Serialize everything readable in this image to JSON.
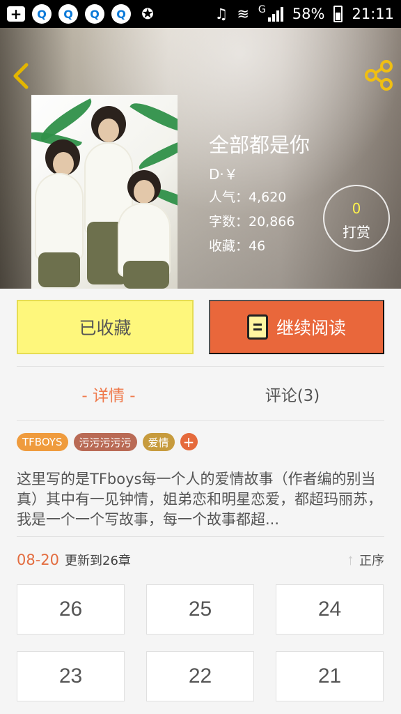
{
  "status_bar": {
    "network": "G",
    "battery": "58%",
    "time": "21:11",
    "icons": [
      "add-icon",
      "qq-icon",
      "qq-icon",
      "qq-icon",
      "qq-icon",
      "weibo-icon",
      "headphone-icon",
      "wifi-icon",
      "signal-icon",
      "battery-icon"
    ]
  },
  "book": {
    "title": "全部都是你",
    "author": "D·￥",
    "popularity_label": "人气：4,620",
    "words_label": "字数：20,866",
    "favorites_label": "收藏：46"
  },
  "tip": {
    "count": "0",
    "label": "打赏"
  },
  "actions": {
    "favorite_label": "已收藏",
    "continue_label": "继续阅读"
  },
  "tabs": {
    "detail": "- 详情 -",
    "comments": "评论(3)"
  },
  "tags": [
    "TFBOYS",
    "污污污污污",
    "爱情"
  ],
  "add_tag": "+",
  "description": "这里写的是TFboys每一个人的爱情故事（作者编的别当真）其中有一见钟情，姐弟恋和明星恋爱，都超玛丽苏，我是一个一个写故事，每一个故事都超...",
  "update": {
    "date": "08-20",
    "text": "更新到26章",
    "sort_label": "正序"
  },
  "chapters": [
    "26",
    "25",
    "24",
    "23",
    "22",
    "21"
  ],
  "colors": {
    "accent": "#e9673b",
    "favorite": "#fef77c",
    "tip": "#fff34c"
  }
}
